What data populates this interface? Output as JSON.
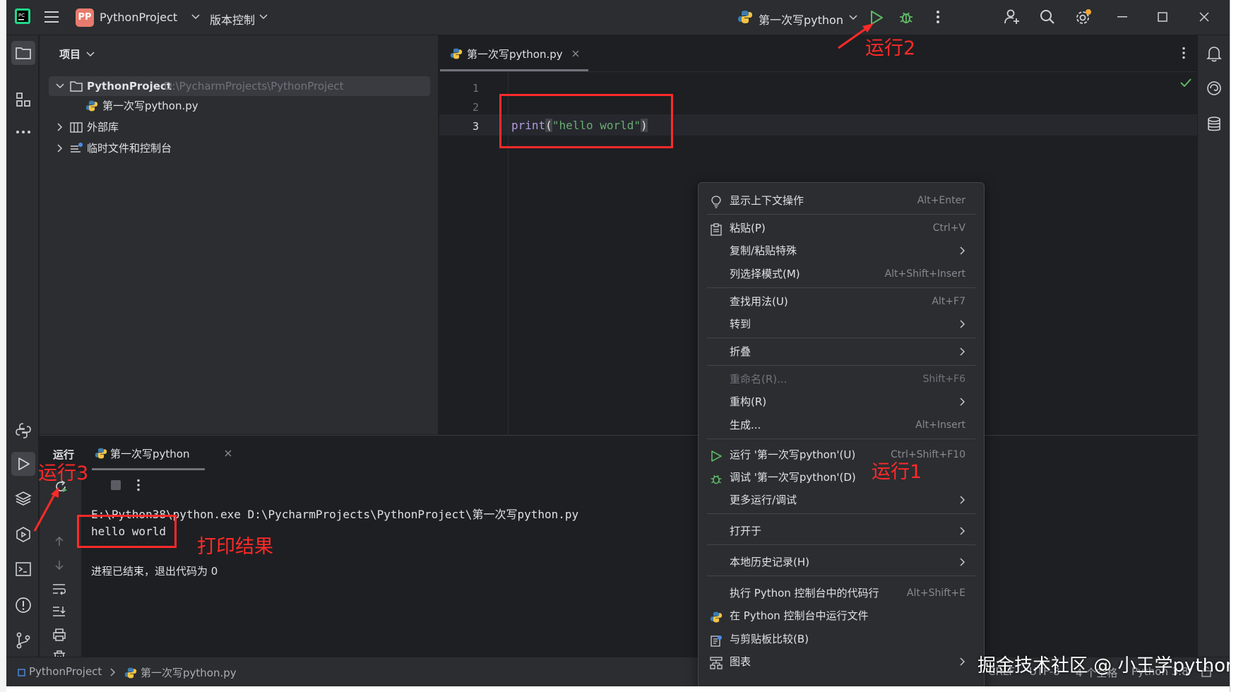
{
  "titlebar": {
    "project_badge": "PP",
    "project_name": "PythonProject",
    "vcs_label": "版本控制",
    "run_config": "第一次写python"
  },
  "project_panel": {
    "title": "项目",
    "tree": [
      {
        "label": "PythonProject",
        "path": "D:\\PycharmProjects\\PythonProject"
      },
      {
        "label": "第一次写python.py"
      },
      {
        "label": "外部库"
      },
      {
        "label": "临时文件和控制台"
      }
    ]
  },
  "editor": {
    "tab_label": "第一次写python.py",
    "line_numbers": [
      "1",
      "2",
      "3"
    ],
    "code": {
      "fn": "print",
      "open": "(",
      "str": "\"hello world\"",
      "close": ")"
    }
  },
  "run_panel": {
    "tab_run": "运行",
    "tab_config": "第一次写python",
    "command": "E:\\Python38\\python.exe D:\\PycharmProjects\\PythonProject\\第一次写python.py",
    "output": "hello world",
    "exit_message": "进程已结束，退出代码为 0"
  },
  "context_menu": {
    "items": [
      {
        "label": "显示上下文操作",
        "shortcut": "Alt+Enter"
      },
      {
        "label": "粘贴(P)",
        "shortcut": "Ctrl+V"
      },
      {
        "label": "复制/粘贴特殊"
      },
      {
        "label": "列选择模式(M)",
        "shortcut": "Alt+Shift+Insert"
      },
      {
        "label": "查找用法(U)",
        "shortcut": "Alt+F7"
      },
      {
        "label": "转到"
      },
      {
        "label": "折叠"
      },
      {
        "label": "重命名(R)...",
        "shortcut": "Shift+F6"
      },
      {
        "label": "重构(R)"
      },
      {
        "label": "生成...",
        "shortcut": "Alt+Insert"
      },
      {
        "label": "运行 '第一次写python'(U)",
        "shortcut": "Ctrl+Shift+F10"
      },
      {
        "label": "调试 '第一次写python'(D)"
      },
      {
        "label": "更多运行/调试"
      },
      {
        "label": "打开于"
      },
      {
        "label": "本地历史记录(H)"
      },
      {
        "label": "执行 Python 控制台中的代码行",
        "shortcut": "Alt+Shift+E"
      },
      {
        "label": "在 Python 控制台中运行文件"
      },
      {
        "label": "与剪贴板比较(B)"
      },
      {
        "label": "图表"
      }
    ]
  },
  "statusbar": {
    "breadcrumb_project": "PythonProject",
    "breadcrumb_file": "第一次写python.py",
    "line_sep": "CRLF",
    "encoding": "UTF-8",
    "indent": "4 个空格",
    "interpreter": "Python 3.8"
  },
  "annotations": {
    "run1": "运行1",
    "run2": "运行2",
    "run3": "运行3",
    "print_result": "打印结果"
  },
  "watermark": "掘金技术社区 @ 小王学python",
  "colors": {
    "background": "#1e1f22",
    "panel": "#2b2d30",
    "annotation_red": "#ff2a2a",
    "run_green": "#5fb865",
    "string_green": "#6aab73",
    "keyword_purple": "#b39ddb"
  }
}
